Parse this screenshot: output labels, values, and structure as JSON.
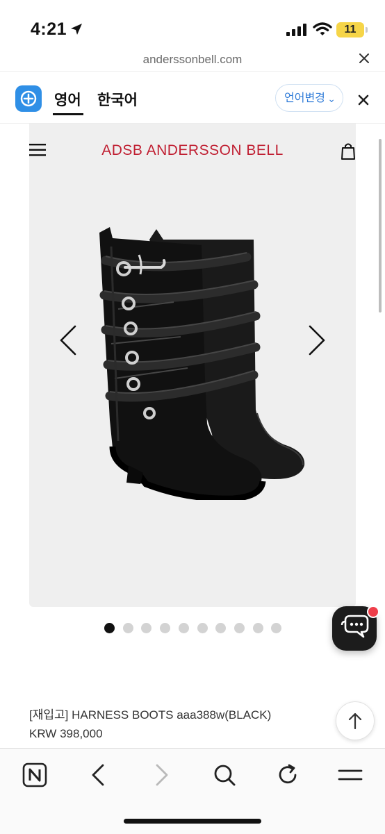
{
  "status_bar": {
    "time": "4:21",
    "battery": "11"
  },
  "browser": {
    "url": "anderssonbell.com"
  },
  "translate_bar": {
    "tab_english": "영어",
    "tab_korean": "한국어",
    "change_language": "언어변경",
    "chevron": "⌄"
  },
  "header": {
    "brand": "ADSB  ANDERSSON BELL"
  },
  "gallery": {
    "image": "black-harness-boots",
    "dot_count": 10,
    "active_index": 0
  },
  "product": {
    "name": "[재입고] HARNESS BOOTS aaa388w(BLACK)",
    "price": "KRW 398,000"
  },
  "icons": {
    "menu": "hamburger-icon",
    "cart": "shopping-bag-icon",
    "chat": "chat-bubble-icon",
    "scroll_top": "arrow-up-icon",
    "bottom_bar": [
      "naver-n-icon",
      "back-icon",
      "forward-icon",
      "search-icon",
      "reload-icon",
      "menu-icon"
    ]
  },
  "colors": {
    "brand": "#c01f32",
    "accent": "#2f7bd8",
    "chat_badge": "#ef3e4a"
  }
}
